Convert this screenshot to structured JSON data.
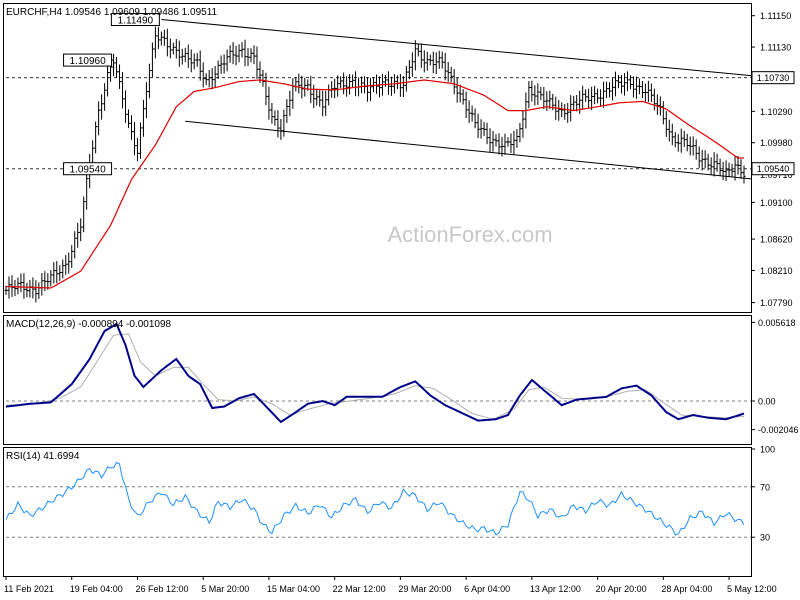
{
  "chart_data": [
    {
      "type": "candlestick",
      "panel": "price",
      "header": "EURCHF,H4  1.09546 1.09609 1.09486 1.09511",
      "watermark": "ActionForex.com",
      "ylim": [
        1.0768,
        1.1168
      ],
      "y_ticks": [
        "1.11150",
        "1.11130",
        "1.10290",
        "1.09980",
        "1.09100",
        "1.08620",
        "1.08210",
        "1.07790"
      ],
      "y_tick_values": [
        1.1154,
        1.1113,
        1.1029,
        1.0988,
        1.091,
        1.0862,
        1.0821,
        1.0779
      ],
      "hidden_tick_label": "1.09710",
      "hidden_tick_value": 1.0951,
      "levels": [
        {
          "label": "1.10730",
          "value": 1.1073,
          "axis_tag": true
        },
        {
          "label": "1.09540",
          "value": 1.0954,
          "axis_tag": true
        }
      ],
      "annotations": [
        {
          "label": "1.11490",
          "value": 1.1149,
          "anchor_bar": 52
        },
        {
          "label": "1.10960",
          "value": 1.1096,
          "anchor_bar": 36
        },
        {
          "label": "1.09540",
          "value": 1.0954,
          "anchor_bar": 36
        }
      ],
      "channel": {
        "upper": [
          [
            52,
            1.1149
          ],
          [
            250,
            1.1076
          ]
        ],
        "lower": [
          [
            60,
            1.1016
          ],
          [
            250,
            1.0941
          ]
        ]
      },
      "close_path": [
        [
          0,
          1.0795
        ],
        [
          5,
          1.08
        ],
        [
          10,
          1.0798
        ],
        [
          15,
          1.081
        ],
        [
          20,
          1.083
        ],
        [
          25,
          1.088
        ],
        [
          28,
          1.096
        ],
        [
          31,
          1.103
        ],
        [
          34,
          1.1078
        ],
        [
          36,
          1.1096
        ],
        [
          38,
          1.106
        ],
        [
          41,
          1.101
        ],
        [
          44,
          1.098
        ],
        [
          47,
          1.106
        ],
        [
          50,
          1.1125
        ],
        [
          53,
          1.112
        ],
        [
          57,
          1.111
        ],
        [
          61,
          1.1095
        ],
        [
          64,
          1.109
        ],
        [
          67,
          1.107
        ],
        [
          71,
          1.1085
        ],
        [
          75,
          1.11
        ],
        [
          79,
          1.111
        ],
        [
          83,
          1.11
        ],
        [
          86,
          1.106
        ],
        [
          89,
          1.102
        ],
        [
          92,
          1.101
        ],
        [
          96,
          1.106
        ],
        [
          101,
          1.106
        ],
        [
          106,
          1.104
        ],
        [
          110,
          1.106
        ],
        [
          116,
          1.107
        ],
        [
          121,
          1.1055
        ],
        [
          127,
          1.107
        ],
        [
          133,
          1.106
        ],
        [
          137,
          1.111
        ],
        [
          141,
          1.1095
        ],
        [
          146,
          1.109
        ],
        [
          151,
          1.106
        ],
        [
          157,
          1.101
        ],
        [
          162,
          1.0995
        ],
        [
          167,
          1.0983
        ],
        [
          171,
          1.099
        ],
        [
          175,
          1.106
        ],
        [
          181,
          1.104
        ],
        [
          186,
          1.103
        ],
        [
          191,
          1.104
        ],
        [
          197,
          1.105
        ],
        [
          203,
          1.106
        ],
        [
          209,
          1.1068
        ],
        [
          214,
          1.1055
        ],
        [
          219,
          1.103
        ],
        [
          223,
          1.0995
        ],
        [
          228,
          1.0985
        ],
        [
          232,
          1.097
        ],
        [
          237,
          1.096
        ],
        [
          241,
          1.0945
        ],
        [
          244,
          1.096
        ],
        [
          247,
          1.0951
        ]
      ],
      "ma_path": [
        [
          0,
          1.08
        ],
        [
          15,
          1.0798
        ],
        [
          25,
          1.082
        ],
        [
          35,
          1.088
        ],
        [
          42,
          1.094
        ],
        [
          50,
          1.0985
        ],
        [
          57,
          1.1035
        ],
        [
          63,
          1.1055
        ],
        [
          70,
          1.106
        ],
        [
          78,
          1.1068
        ],
        [
          85,
          1.107
        ],
        [
          93,
          1.1065
        ],
        [
          101,
          1.1058
        ],
        [
          110,
          1.1057
        ],
        [
          120,
          1.1062
        ],
        [
          130,
          1.1065
        ],
        [
          140,
          1.107
        ],
        [
          150,
          1.1065
        ],
        [
          160,
          1.105
        ],
        [
          168,
          1.103
        ],
        [
          174,
          1.103
        ],
        [
          181,
          1.1035
        ],
        [
          190,
          1.103
        ],
        [
          198,
          1.1035
        ],
        [
          205,
          1.104
        ],
        [
          213,
          1.1042
        ],
        [
          221,
          1.1032
        ],
        [
          229,
          1.101
        ],
        [
          237,
          1.099
        ],
        [
          245,
          1.0968
        ]
      ]
    },
    {
      "type": "line",
      "panel": "macd",
      "header": "MACD(12,26,9) -0.000894 -0.001098",
      "ylim": [
        -0.003,
        0.006
      ],
      "y_ticks": [
        "0.005618",
        "0.00",
        "-0.002046"
      ],
      "y_tick_values": [
        0.005618,
        0.0,
        -0.002046
      ],
      "zero_line": 0.0,
      "series": [
        {
          "role": "macd",
          "color": "#00008b",
          "points": [
            [
              0,
              -0.0004
            ],
            [
              8,
              -0.0002
            ],
            [
              15,
              -0.0001
            ],
            [
              22,
              0.0012
            ],
            [
              28,
              0.003
            ],
            [
              33,
              0.005
            ],
            [
              37,
              0.0055
            ],
            [
              40,
              0.004
            ],
            [
              43,
              0.0018
            ],
            [
              46,
              0.001
            ],
            [
              52,
              0.0022
            ],
            [
              57,
              0.003
            ],
            [
              61,
              0.0018
            ],
            [
              65,
              0.0012
            ],
            [
              69,
              -0.0005
            ],
            [
              73,
              -0.0004
            ],
            [
              78,
              0.0002
            ],
            [
              83,
              0.0005
            ],
            [
              88,
              -0.0006
            ],
            [
              92,
              -0.0015
            ],
            [
              97,
              -0.0008
            ],
            [
              101,
              -0.0002
            ],
            [
              106,
              0.0
            ],
            [
              110,
              -0.0003
            ],
            [
              114,
              0.0003
            ],
            [
              120,
              0.0003
            ],
            [
              126,
              0.0003
            ],
            [
              132,
              0.001
            ],
            [
              137,
              0.0014
            ],
            [
              142,
              0.0004
            ],
            [
              147,
              -0.0003
            ],
            [
              152,
              -0.0008
            ],
            [
              158,
              -0.0014
            ],
            [
              164,
              -0.0013
            ],
            [
              168,
              -0.001
            ],
            [
              172,
              0.0004
            ],
            [
              176,
              0.0015
            ],
            [
              181,
              0.0006
            ],
            [
              186,
              -0.0003
            ],
            [
              191,
              0.0001
            ],
            [
              196,
              0.0002
            ],
            [
              201,
              0.0003
            ],
            [
              206,
              0.0009
            ],
            [
              211,
              0.0011
            ],
            [
              216,
              0.0004
            ],
            [
              221,
              -0.0008
            ],
            [
              225,
              -0.0013
            ],
            [
              230,
              -0.001
            ],
            [
              235,
              -0.0012
            ],
            [
              241,
              -0.0013
            ],
            [
              247,
              -0.0009
            ]
          ]
        },
        {
          "role": "signal",
          "color": "#b0b0b0",
          "points": [
            [
              0,
              -0.0003
            ],
            [
              10,
              -0.0002
            ],
            [
              18,
              0.0002
            ],
            [
              25,
              0.001
            ],
            [
              31,
              0.003
            ],
            [
              36,
              0.0047
            ],
            [
              41,
              0.0048
            ],
            [
              45,
              0.0028
            ],
            [
              50,
              0.0018
            ],
            [
              56,
              0.0024
            ],
            [
              61,
              0.0024
            ],
            [
              66,
              0.0012
            ],
            [
              71,
              0.0001
            ],
            [
              77,
              0.0
            ],
            [
              83,
              0.0003
            ],
            [
              89,
              -0.0002
            ],
            [
              95,
              -0.001
            ],
            [
              101,
              -0.0006
            ],
            [
              108,
              -0.0002
            ],
            [
              115,
              0.0
            ],
            [
              122,
              0.0002
            ],
            [
              130,
              0.0005
            ],
            [
              137,
              0.0011
            ],
            [
              143,
              0.0009
            ],
            [
              149,
              0.0001
            ],
            [
              156,
              -0.0009
            ],
            [
              163,
              -0.0013
            ],
            [
              170,
              -0.0006
            ],
            [
              175,
              0.0008
            ],
            [
              180,
              0.001
            ],
            [
              186,
              0.0002
            ],
            [
              193,
              0.0001
            ],
            [
              201,
              0.0003
            ],
            [
              208,
              0.0007
            ],
            [
              214,
              0.0008
            ],
            [
              220,
              -0.0001
            ],
            [
              226,
              -0.001
            ],
            [
              233,
              -0.0011
            ],
            [
              240,
              -0.0012
            ],
            [
              247,
              -0.0011
            ]
          ]
        }
      ]
    },
    {
      "type": "line",
      "panel": "rsi",
      "header": "RSI(14) 41.6994",
      "ylim": [
        0,
        100
      ],
      "y_ticks": [
        "100",
        "70",
        "30"
      ],
      "y_tick_values": [
        100,
        70,
        30
      ],
      "reference_lines": [
        70,
        30
      ],
      "series": [
        {
          "role": "rsi",
          "color": "#1e90ff",
          "points": [
            [
              0,
              44
            ],
            [
              4,
              56
            ],
            [
              8,
              47
            ],
            [
              12,
              53
            ],
            [
              16,
              60
            ],
            [
              20,
              66
            ],
            [
              24,
              74
            ],
            [
              28,
              84
            ],
            [
              32,
              79
            ],
            [
              35,
              86
            ],
            [
              38,
              88
            ],
            [
              41,
              60
            ],
            [
              44,
              46
            ],
            [
              48,
              58
            ],
            [
              52,
              66
            ],
            [
              56,
              56
            ],
            [
              60,
              62
            ],
            [
              64,
              50
            ],
            [
              68,
              42
            ],
            [
              71,
              58
            ],
            [
              75,
              54
            ],
            [
              79,
              60
            ],
            [
              83,
              52
            ],
            [
              86,
              40
            ],
            [
              89,
              34
            ],
            [
              93,
              47
            ],
            [
              97,
              55
            ],
            [
              101,
              49
            ],
            [
              105,
              56
            ],
            [
              109,
              46
            ],
            [
              113,
              55
            ],
            [
              117,
              60
            ],
            [
              121,
              50
            ],
            [
              125,
              58
            ],
            [
              129,
              53
            ],
            [
              133,
              66
            ],
            [
              137,
              63
            ],
            [
              141,
              52
            ],
            [
              145,
              58
            ],
            [
              149,
              48
            ],
            [
              153,
              41
            ],
            [
              157,
              36
            ],
            [
              160,
              37
            ],
            [
              164,
              33
            ],
            [
              168,
              40
            ],
            [
              172,
              66
            ],
            [
              175,
              60
            ],
            [
              178,
              47
            ],
            [
              182,
              52
            ],
            [
              186,
              45
            ],
            [
              190,
              55
            ],
            [
              194,
              51
            ],
            [
              198,
              59
            ],
            [
              202,
              55
            ],
            [
              206,
              64
            ],
            [
              210,
              58
            ],
            [
              214,
              52
            ],
            [
              218,
              45
            ],
            [
              222,
              38
            ],
            [
              225,
              32
            ],
            [
              229,
              45
            ],
            [
              233,
              50
            ],
            [
              237,
              41
            ],
            [
              241,
              49
            ],
            [
              245,
              43
            ],
            [
              247,
              42
            ]
          ]
        }
      ]
    }
  ],
  "x_axis": {
    "labels": [
      "11 Feb 2021",
      "19 Feb 04:00",
      "26 Feb 12:00",
      "5 Mar 20:00",
      "15 Mar 04:00",
      "22 Mar 12:00",
      "29 Mar 20:00",
      "6 Apr 04:00",
      "13 Apr 12:00",
      "20 Apr 20:00",
      "28 Apr 04:00",
      "5 May 12:00"
    ],
    "positions": [
      0,
      22,
      44,
      66,
      88,
      110,
      132,
      154,
      176,
      198,
      220,
      242
    ],
    "bar_count": 248
  },
  "colors": {
    "background": "#ffffff",
    "bars": "#000000",
    "ma": "#e00000",
    "macd": "#00008b",
    "signal": "#b0b0b0",
    "rsi": "#1e90ff",
    "channel": "#000000",
    "grid": "#7f7f7f",
    "watermark": "#c8c8c8",
    "level_box": "#000000"
  }
}
